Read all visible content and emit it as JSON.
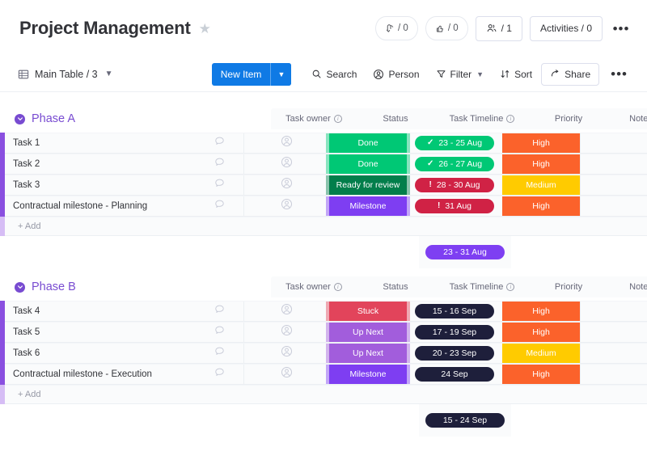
{
  "header": {
    "title": "Project Management",
    "star_icon": "star-icon",
    "counters": [
      {
        "icon": "activity-pulse-icon",
        "label": "/ 0",
        "name": "updates-counter"
      },
      {
        "icon": "like-thumb-icon",
        "label": "/ 0",
        "name": "likes-counter"
      }
    ],
    "people_button": {
      "icon": "people-icon",
      "label": "/ 1"
    },
    "activities_button": {
      "label": "Activities / 0"
    },
    "more_button": {
      "icon": "more-horizontal-icon",
      "label": "•••"
    }
  },
  "toolbar": {
    "table_icon": "table-icon",
    "table_label": "Main Table / 3",
    "table_chevron": "chevron-down-icon",
    "new_item_label": "New Item",
    "new_item_chevron": "chevron-down-icon",
    "search_label": "Search",
    "person_label": "Person",
    "filter_label": "Filter",
    "sort_label": "Sort",
    "share_label": "Share",
    "more_label": "•••"
  },
  "columns": [
    {
      "label": "Task owner",
      "info": true
    },
    {
      "label": "Status",
      "info": false
    },
    {
      "label": "Task Timeline",
      "info": true
    },
    {
      "label": "Priority",
      "info": false
    },
    {
      "label": "Notes",
      "info": false
    }
  ],
  "colors": {
    "accent_blue": "#0f7ae5",
    "group_purple": "#784bd1",
    "row_strip_purple": "#8a4fe0",
    "done_green": "#00c875",
    "ready_green": "#037f4c",
    "milestone_purple": "#7e3ff2",
    "stuck_red": "#e2445c",
    "upnext_purple": "#a25ddc",
    "high_orange": "#fb622b",
    "medium_yellow": "#ffcb00",
    "timeline_dark": "#1e1f3b",
    "timeline_green": "#00c875",
    "timeline_red": "#d02245"
  },
  "groups": [
    {
      "name": "Phase A",
      "caret_icon": "chevron-down-circle-icon",
      "color": "#784bd1",
      "add_label": "+ Add",
      "items": [
        {
          "title": "Task 1",
          "chat_icon": "comment-icon",
          "owner_icon": "avatar-placeholder-icon",
          "status": {
            "label": "Done",
            "color": "#00c875"
          },
          "timeline": {
            "label": "23 - 25 Aug",
            "color": "#00c875",
            "icon": "check-icon",
            "icon_glyph": "✓"
          },
          "priority": {
            "label": "High",
            "color": "#fb622b"
          },
          "notes": ""
        },
        {
          "title": "Task 2",
          "chat_icon": "comment-icon",
          "owner_icon": "avatar-placeholder-icon",
          "status": {
            "label": "Done",
            "color": "#00c875"
          },
          "timeline": {
            "label": "26 - 27 Aug",
            "color": "#00c875",
            "icon": "check-icon",
            "icon_glyph": "✓"
          },
          "priority": {
            "label": "High",
            "color": "#fb622b"
          },
          "notes": ""
        },
        {
          "title": "Task 3",
          "chat_icon": "comment-icon",
          "owner_icon": "avatar-placeholder-icon",
          "status": {
            "label": "Ready for review",
            "color": "#037f4c"
          },
          "timeline": {
            "label": "28 - 30 Aug",
            "color": "#d02245",
            "icon": "alert-icon",
            "icon_glyph": "!"
          },
          "priority": {
            "label": "Medium",
            "color": "#ffcb00"
          },
          "notes": ""
        },
        {
          "title": "Contractual milestone - Planning",
          "chat_icon": "comment-icon",
          "owner_icon": "avatar-placeholder-icon",
          "status": {
            "label": "Milestone",
            "color": "#7e3ff2"
          },
          "timeline": {
            "label": "31 Aug",
            "color": "#d02245",
            "icon": "alert-icon",
            "icon_glyph": "!"
          },
          "priority": {
            "label": "High",
            "color": "#fb622b"
          },
          "notes": ""
        }
      ],
      "summary": {
        "label": "23 - 31 Aug",
        "color": "#7e3ff2"
      }
    },
    {
      "name": "Phase B",
      "caret_icon": "chevron-down-circle-icon",
      "color": "#784bd1",
      "add_label": "+ Add",
      "items": [
        {
          "title": "Task 4",
          "chat_icon": "comment-icon",
          "owner_icon": "avatar-placeholder-icon",
          "status": {
            "label": "Stuck",
            "color": "#e2445c"
          },
          "timeline": {
            "label": "15 - 16 Sep",
            "color": "#1e1f3b",
            "icon": "",
            "icon_glyph": ""
          },
          "priority": {
            "label": "High",
            "color": "#fb622b"
          },
          "notes": ""
        },
        {
          "title": "Task 5",
          "chat_icon": "comment-icon",
          "owner_icon": "avatar-placeholder-icon",
          "status": {
            "label": "Up Next",
            "color": "#a25ddc"
          },
          "timeline": {
            "label": "17 - 19 Sep",
            "color": "#1e1f3b",
            "icon": "",
            "icon_glyph": ""
          },
          "priority": {
            "label": "High",
            "color": "#fb622b"
          },
          "notes": ""
        },
        {
          "title": "Task 6",
          "chat_icon": "comment-icon",
          "owner_icon": "avatar-placeholder-icon",
          "status": {
            "label": "Up Next",
            "color": "#a25ddc"
          },
          "timeline": {
            "label": "20 - 23 Sep",
            "color": "#1e1f3b",
            "icon": "",
            "icon_glyph": ""
          },
          "priority": {
            "label": "Medium",
            "color": "#ffcb00"
          },
          "notes": ""
        },
        {
          "title": "Contractual milestone - Execution",
          "chat_icon": "comment-icon",
          "owner_icon": "avatar-placeholder-icon",
          "status": {
            "label": "Milestone",
            "color": "#7e3ff2"
          },
          "timeline": {
            "label": "24 Sep",
            "color": "#1e1f3b",
            "icon": "",
            "icon_glyph": ""
          },
          "priority": {
            "label": "High",
            "color": "#fb622b"
          },
          "notes": ""
        }
      ],
      "summary": {
        "label": "15 - 24 Sep",
        "color": "#1e1f3b"
      }
    }
  ]
}
